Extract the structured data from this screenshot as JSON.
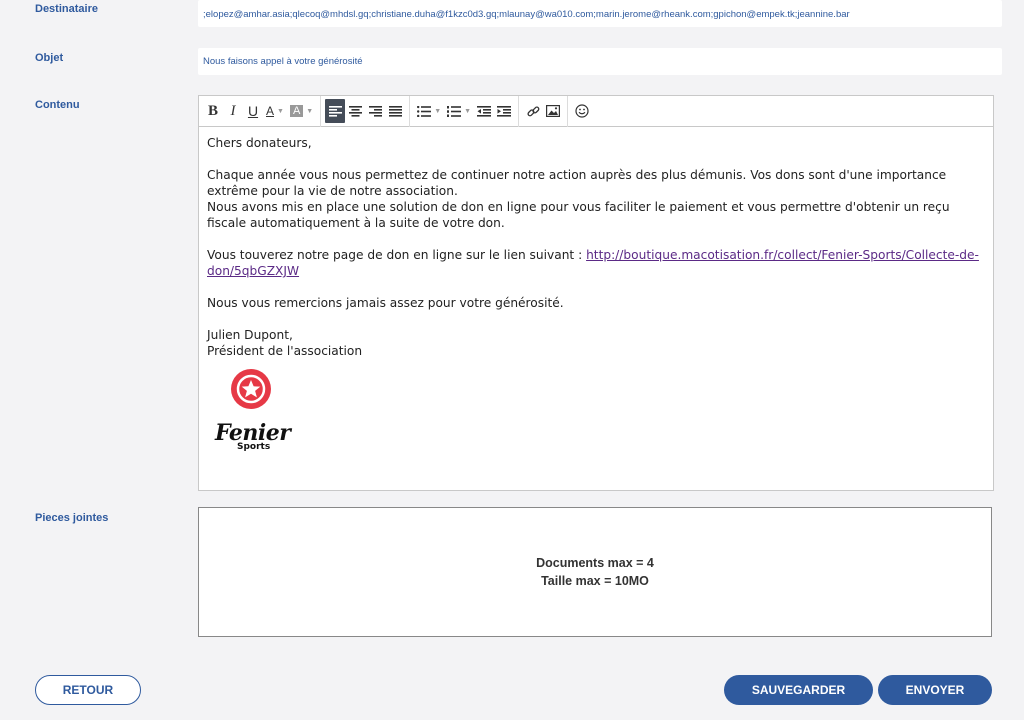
{
  "labels": {
    "recipient": "Destinataire",
    "subject": "Objet",
    "content": "Contenu",
    "attachments": "Pieces jointes"
  },
  "recipient_value": ";elopez@amhar.asia;qlecoq@mhdsl.gq;christiane.duha@f1kzc0d3.gq;mlaunay@wa010.com;marin.jerome@rheank.com;gpichon@empek.tk;jeannine.bar",
  "subject_value": "Nous faisons appel à votre générosité",
  "toolbar": {
    "bold": "B",
    "italic": "I",
    "underline": "U",
    "font_color": "A",
    "highlight": "A"
  },
  "body": {
    "greeting": "Chers donateurs,",
    "para1_line1": "Chaque année vous nous permettez de continuer notre action auprès des plus démunis. Vos dons sont d'une importance extrême pour la vie de notre association.",
    "para1_line2": "Nous avons mis en place une solution de don en ligne pour vous faciliter le paiement et vous permettre d'obtenir un reçu fiscale automatiquement à la suite de votre don.",
    "link_intro": "Vous touverez notre page de don en ligne sur le lien suivant : ",
    "link_text": "http://boutique.macotisation.fr/collect/Fenier-Sports/Collecte-de-don/5qbGZXJW",
    "thanks": "Nous vous remercions jamais assez pour votre générosité.",
    "signature_name": "Julien Dupont,",
    "signature_role": "Président de l'association"
  },
  "logo": {
    "name": "Fenier",
    "sub": "Sports",
    "color": "#e63946"
  },
  "attachments": {
    "max_docs": "Documents max = 4",
    "max_size": "Taille max = 10MO"
  },
  "buttons": {
    "back": "RETOUR",
    "save": "SAUVEGARDER",
    "send": "ENVOYER"
  },
  "colors": {
    "accent": "#2f5a9e",
    "link": "#5b2a86"
  }
}
